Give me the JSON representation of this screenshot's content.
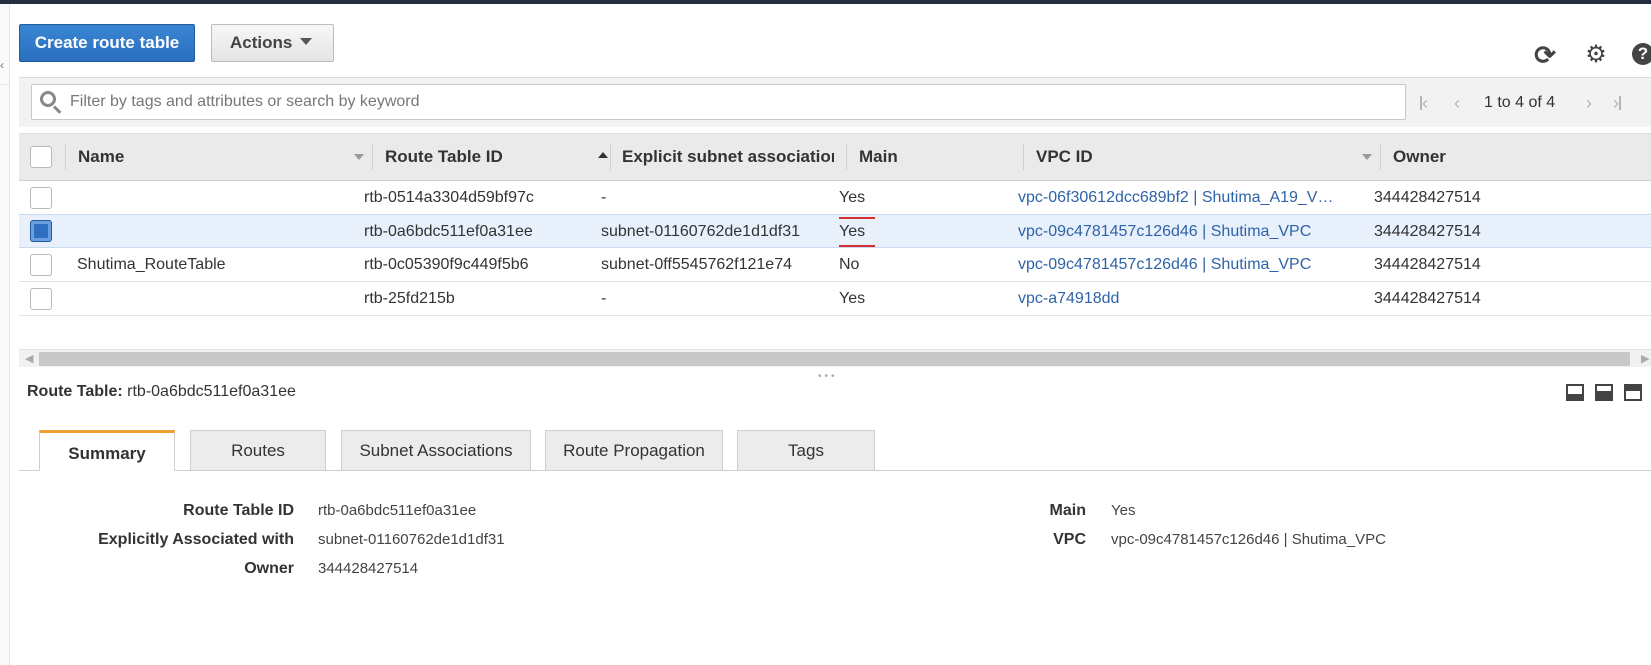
{
  "toolbar": {
    "create_label": "Create route table",
    "actions_label": "Actions",
    "refresh_icon": "refresh-icon",
    "settings_icon": "gear-icon",
    "help_icon": "help-icon",
    "help_glyph": "?"
  },
  "search": {
    "placeholder": "Filter by tags and attributes or search by keyword"
  },
  "pagination": {
    "text": "1 to 4 of 4"
  },
  "table": {
    "headers": {
      "name": "Name",
      "route_table_id": "Route Table ID",
      "explicit": "Explicit subnet associatior",
      "main": "Main",
      "vpc_id": "VPC ID",
      "owner": "Owner"
    },
    "rows": [
      {
        "name": "",
        "route_table_id": "rtb-0514a3304d59bf97c",
        "explicit": "-",
        "main": "Yes",
        "vpc_id": "vpc-06f30612dcc689bf2 | Shutima_A19_V…",
        "owner": "344428427514",
        "selected": false
      },
      {
        "name": "",
        "route_table_id": "rtb-0a6bdc511ef0a31ee",
        "explicit": "subnet-01160762de1d1df31",
        "main": "Yes",
        "vpc_id": "vpc-09c4781457c126d46 | Shutima_VPC",
        "owner": "344428427514",
        "selected": true
      },
      {
        "name": "Shutima_RouteTable",
        "route_table_id": "rtb-0c05390f9c449f5b6",
        "explicit": "subnet-0ff5545762f121e74",
        "main": "No",
        "vpc_id": "vpc-09c4781457c126d46 | Shutima_VPC",
        "owner": "344428427514",
        "selected": false
      },
      {
        "name": "",
        "route_table_id": "rtb-25fd215b",
        "explicit": "-",
        "main": "Yes",
        "vpc_id": "vpc-a74918dd",
        "owner": "344428427514",
        "selected": false
      }
    ]
  },
  "detail": {
    "title_label": "Route Table:",
    "title_value": "rtb-0a6bdc511ef0a31ee",
    "tabs": [
      "Summary",
      "Routes",
      "Subnet Associations",
      "Route Propagation",
      "Tags"
    ],
    "active_tab": "Summary",
    "summary": {
      "route_table_id_label": "Route Table ID",
      "route_table_id": "rtb-0a6bdc511ef0a31ee",
      "explicit_label": "Explicitly Associated with",
      "explicit": "subnet-01160762de1d1df31",
      "owner_label": "Owner",
      "owner": "344428427514",
      "main_label": "Main",
      "main": "Yes",
      "vpc_label": "VPC",
      "vpc": "vpc-09c4781457c126d46 | Shutima_VPC"
    }
  },
  "colors": {
    "primary_button": "#2a6fbf",
    "link": "#2f63a8",
    "highlight_box": "#d32f2f",
    "active_tab_accent": "#f0a030",
    "selected_row": "#e8f0fb"
  }
}
